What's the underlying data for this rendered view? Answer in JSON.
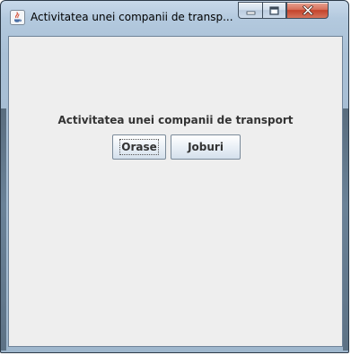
{
  "window": {
    "title": "Activitatea unei companii de transp...",
    "icon": "java-coffee-cup-icon"
  },
  "caption_buttons": {
    "minimize_icon": "minimize-icon",
    "maximize_icon": "maximize-icon",
    "close_icon": "close-icon"
  },
  "main": {
    "heading": "Activitatea unei companii de transport",
    "buttons": [
      {
        "label": "Orase",
        "focused": true
      },
      {
        "label": "Joburi",
        "focused": false
      }
    ]
  },
  "colors": {
    "client_background": "#eeeeee",
    "text": "#333333",
    "close_button": "#c4432b",
    "frame": "#b3c9de"
  }
}
